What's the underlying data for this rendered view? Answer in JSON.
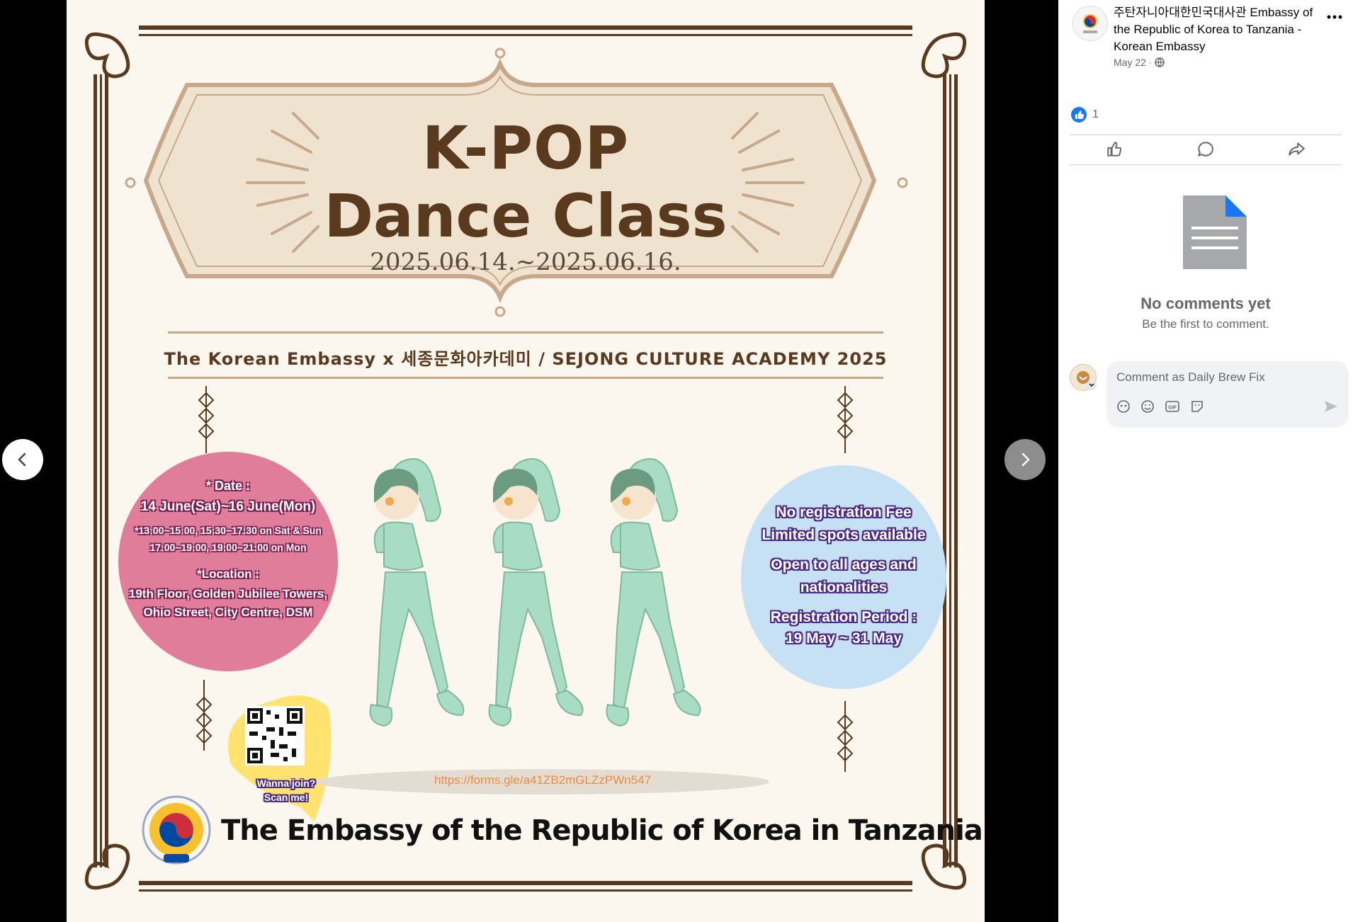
{
  "poster": {
    "title_line1": "K-POP",
    "title_line2": "Dance Class",
    "date_range": "2025.06.14.~2025.06.16.",
    "organizer_line": "The Korean Embassy x 세종문화아카데미 / SEJONG CULTURE ACADEMY 2025",
    "date_heading": "* Date :",
    "date_value": "14 June(Sat)~16 June(Mon)",
    "time_line1": "*13:00~15:00, 15:30~17:30 on Sat & Sun",
    "time_line2": "17:00~19:00, 19:00~21:00 on Mon",
    "location_heading": "*Location :",
    "location_line1": "19th Floor, Golden Jubilee Towers,",
    "location_line2": "Ohio Street, City Centre, DSM",
    "info_line1": "No registration Fee",
    "info_line2": "Limited spots available",
    "info_line3": "Open to all ages and",
    "info_line4": "nationalities",
    "info_line5": "Registration Period :",
    "info_line6": "19 May ~ 31 May",
    "qr_caption1": "Wanna join?",
    "qr_caption2": "Scan me!",
    "form_url": "https://forms.gle/a41ZB2mGLZzPWn547",
    "footer": "The Embassy of the Republic of Korea in Tanzania"
  },
  "colors": {
    "brown": "#5a3a1e",
    "frame_tan": "#c8a88a",
    "pink_bubble": "#e07d9b",
    "blue_bubble": "#c7e1f4",
    "yellow_bubble": "#ffe270",
    "dancer_green": "#a8dcc4",
    "hair_green": "#6b9b80",
    "url_orange": "#f08a3c",
    "facebook_blue": "#1877f2"
  },
  "post": {
    "page_name": "주탄자니아대한민국대사관 Embassy of the Republic of Korea to Tanzania - Korean Embassy",
    "date": "May 22",
    "reaction_count": "1",
    "empty_title": "No comments yet",
    "empty_subtitle": "Be the first to comment.",
    "comment_placeholder": "Comment as Daily Brew Fix"
  },
  "icons": {
    "prev": "chevron-left-icon",
    "next": "chevron-right-icon",
    "more": "more-options-icon",
    "globe": "globe-icon",
    "like_badge": "like-reaction-icon",
    "like": "thumbs-up-icon",
    "comment": "comment-bubble-icon",
    "share": "share-arrow-icon",
    "document": "document-icon",
    "avatar_sticker": "avatar-sticker-icon",
    "emoji": "smiley-icon",
    "gif": "gif-icon",
    "sticker": "sticker-icon",
    "send": "send-icon"
  }
}
